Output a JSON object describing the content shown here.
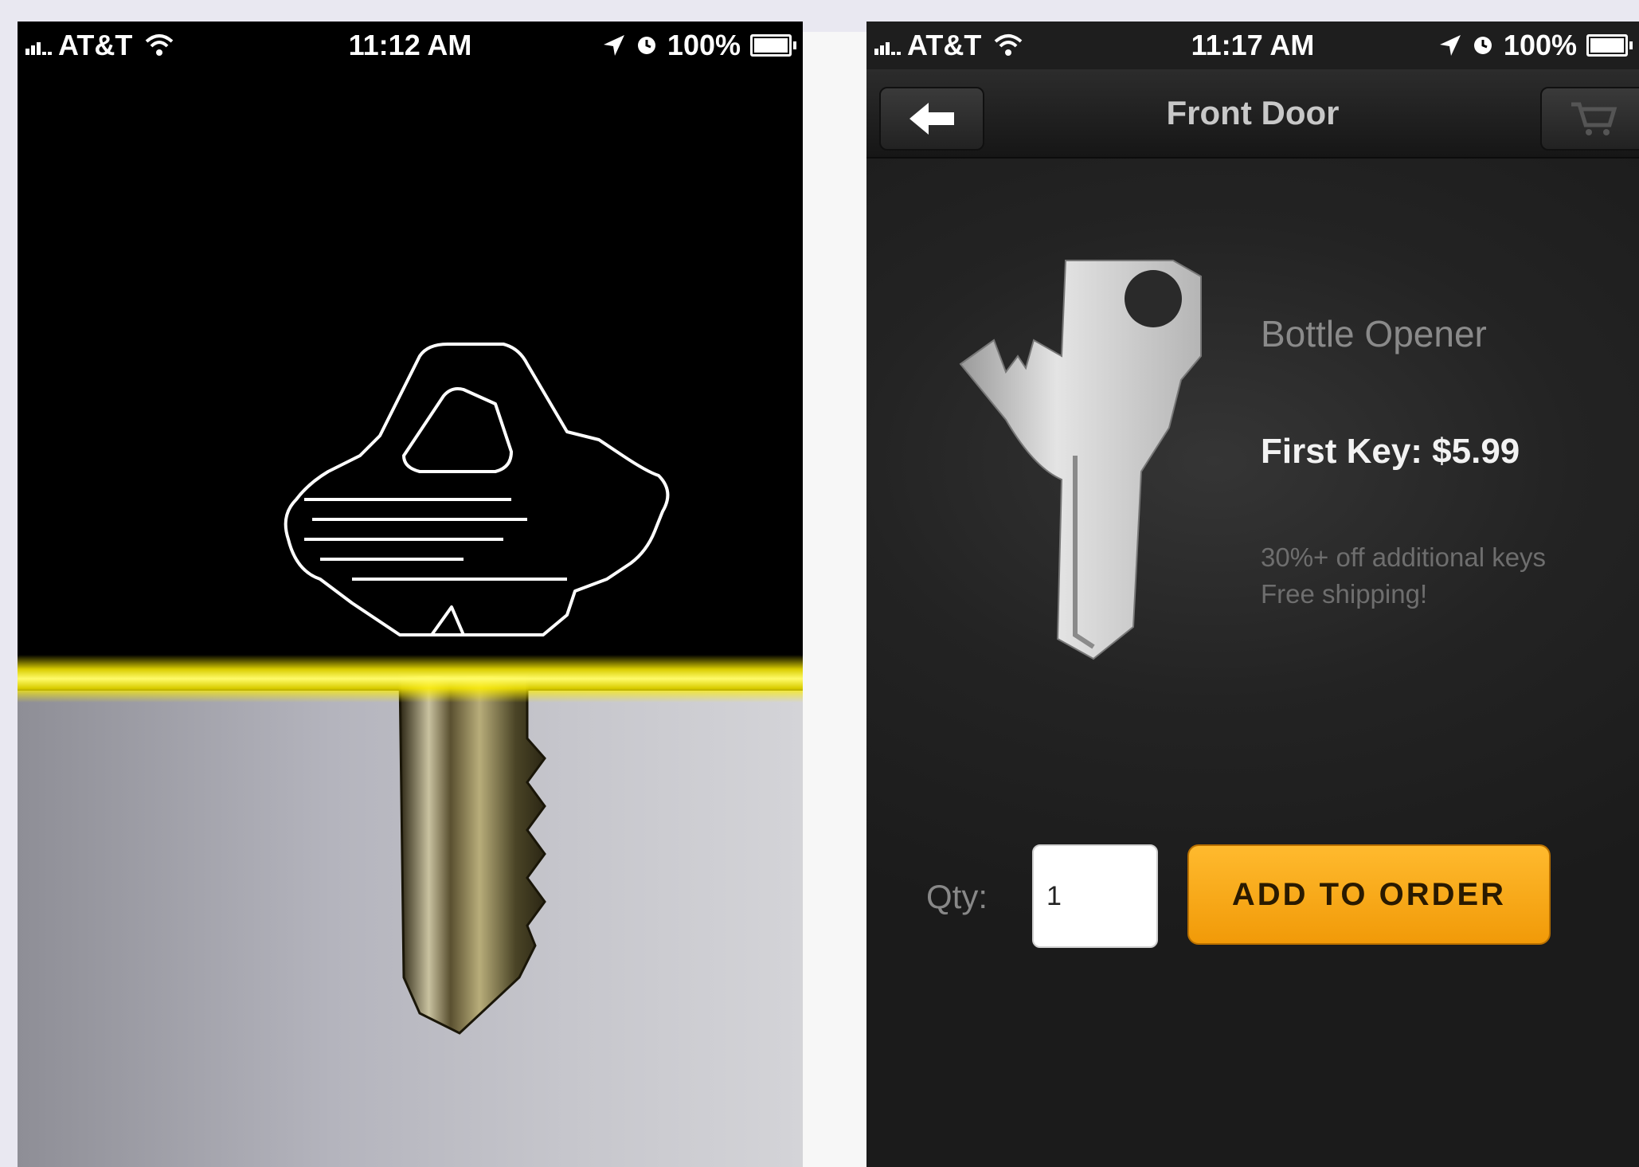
{
  "left_screen": {
    "status": {
      "carrier": "AT&T",
      "time": "11:12 AM",
      "battery": "100%"
    },
    "scan_line_color": "#fff200"
  },
  "right_screen": {
    "status": {
      "carrier": "AT&T",
      "time": "11:17 AM",
      "battery": "100%"
    },
    "nav": {
      "title": "Front Door",
      "back_icon": "arrow-left-icon",
      "cart_icon": "cart-icon"
    },
    "product": {
      "name": "Bottle Opener",
      "price": "First Key: $5.99",
      "promo_line1": "30%+ off additional keys",
      "promo_line2": "Free shipping!"
    },
    "qty": {
      "label": "Qty:",
      "value": "1"
    },
    "add_button": "ADD TO ORDER",
    "accent": "#f5a623"
  }
}
